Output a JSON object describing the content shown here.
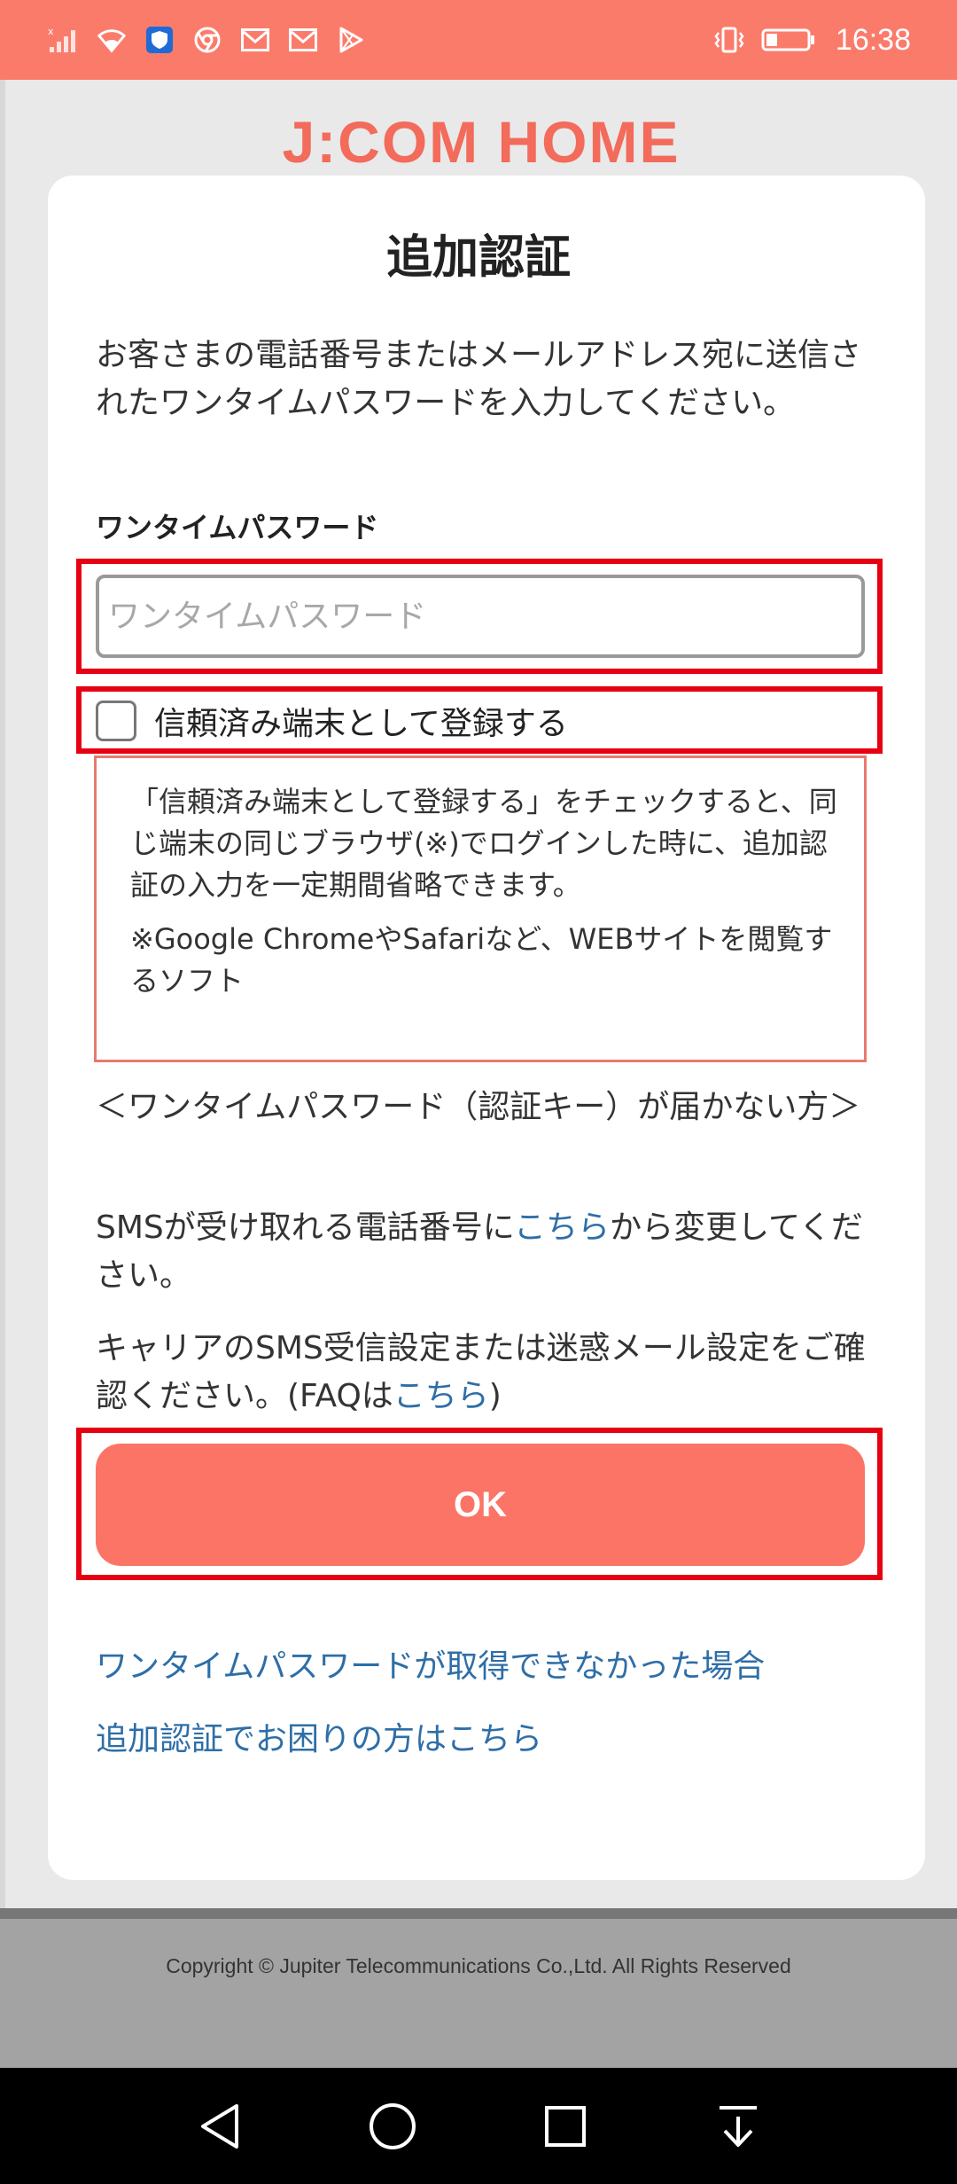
{
  "status_bar": {
    "time": "16:38",
    "left_icons": [
      "no-signal-icon",
      "wifi-icon",
      "shield-app-icon",
      "chrome-icon",
      "mail-icon",
      "mail-icon",
      "play-store-icon"
    ],
    "right_icons": [
      "vibrate-icon",
      "battery-icon"
    ]
  },
  "brand": "J:COM HOME",
  "card": {
    "title": "追加認証",
    "intro": "お客さまの電話番号またはメールアドレス宛に送信されたワンタイムパスワードを入力してください。",
    "otp_label": "ワンタイムパスワード",
    "otp_placeholder": "ワンタイムパスワード",
    "otp_value": "",
    "trust_label": "信頼済み端末として登録する",
    "trust_checked": false,
    "note_p1": "「信頼済み端末として登録する」をチェックすると、同じ端末の同じブラウザ(※)でログインした時に、追加認証の入力を一定期間省略できます。",
    "note_p2": "※Google ChromeやSafariなど、WEBサイトを閲覧するソフト",
    "help_heading": "＜ワンタイムパスワード（認証キー）が届かない方＞",
    "help_sms_pre": "SMSが受け取れる電話番号に",
    "help_sms_link": "こちら",
    "help_sms_post": "から変更してください。",
    "help_carrier_pre": "キャリアのSMS受信設定または迷惑メール設定をご確認ください。(FAQは",
    "help_carrier_link": "こちら",
    "help_carrier_post": ")",
    "ok_label": "OK",
    "link_no_otp": "ワンタイムパスワードが取得できなかった場合",
    "link_trouble": "追加認証でお困りの方はこちら"
  },
  "footer": {
    "copyright": "Copyright © Jupiter Telecommunications Co.,Ltd. All Rights Reserved"
  },
  "nav_bar": {
    "buttons": [
      "back-icon",
      "home-icon",
      "recents-icon",
      "notification-pull-icon"
    ]
  },
  "colors": {
    "accent": "#fb7466",
    "link": "#2e6ea7",
    "highlight": "#e60012"
  }
}
